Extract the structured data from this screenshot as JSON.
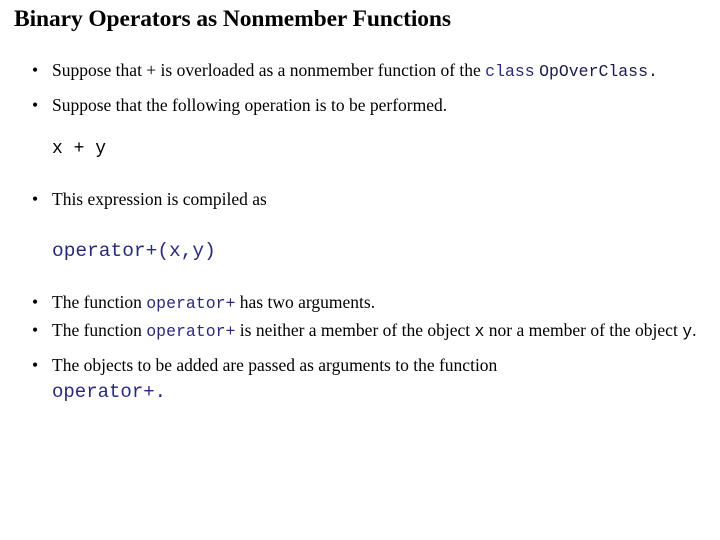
{
  "slide": {
    "title": "Binary Operators as Nonmember Functions",
    "bullet_marker": "•",
    "colors": {
      "text": "#000000",
      "code_blue": "#2a2a7c",
      "code_black": "#000000",
      "background": "#ffffff"
    },
    "items": [
      {
        "id": "bullet-1",
        "parts": [
          {
            "kind": "text",
            "value": "Suppose that + is overloaded as a nonmember function of the "
          },
          {
            "kind": "code",
            "value": "class"
          },
          {
            "kind": "text",
            "value": " "
          },
          {
            "kind": "code_dark",
            "value": "OpOverClass."
          }
        ],
        "line1": "Suppose that + is overloaded as a nonmember function of the",
        "line2_code_keyword": "class",
        "line2_code_name": "OpOverClass."
      },
      {
        "id": "bullet-2",
        "text": "Suppose that the following operation is to be performed."
      },
      {
        "id": "code-block-1",
        "code": "x + y"
      },
      {
        "id": "bullet-3",
        "text": "This expression is compiled as"
      },
      {
        "id": "code-block-2",
        "code": "operator+(x,y)"
      },
      {
        "id": "bullet-4",
        "prefix": "The function ",
        "code": "operator+",
        "suffix": " has two arguments."
      },
      {
        "id": "bullet-5",
        "prefix": "The function ",
        "code": "operator+",
        "mid": " is neither a member of the object ",
        "code2": "x",
        "mid2": " nor a member of the object ",
        "code3": "y",
        "suffix": "."
      },
      {
        "id": "bullet-6",
        "text": "The objects to be added are passed as arguments to the function",
        "code": "operator+."
      }
    ]
  }
}
